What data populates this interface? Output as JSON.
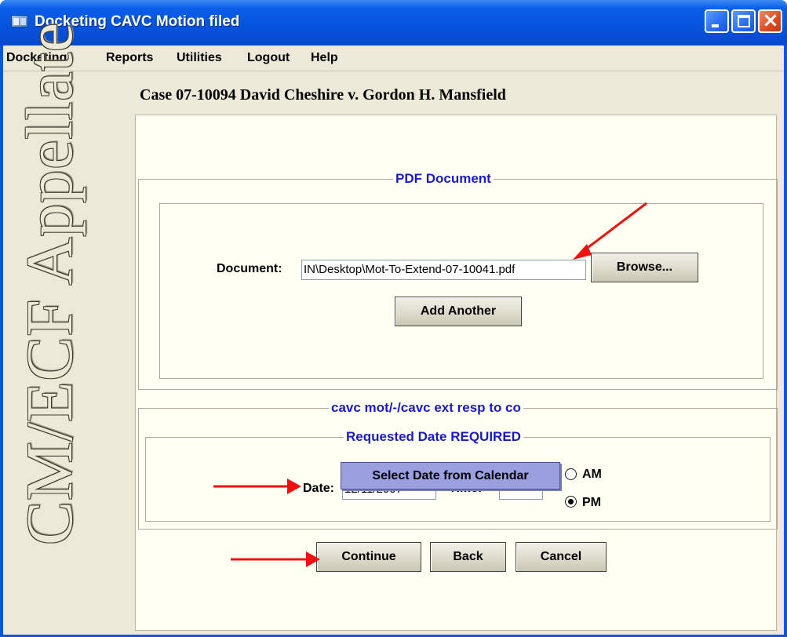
{
  "window": {
    "title": "Docketing CAVC Motion filed",
    "controls": [
      "minimize",
      "maximize",
      "close"
    ]
  },
  "menu": {
    "items": [
      "Docketing",
      "Reports",
      "Utilities",
      "Logout",
      "Help"
    ]
  },
  "sidebar": {
    "vertical_label": "CM/ECF Appellate"
  },
  "case": {
    "title": "Case 07-10094 David Cheshire v. Gordon H. Mansfield"
  },
  "pdf_section": {
    "legend": "PDF Document",
    "document_label": "Document:",
    "document_value": "IN\\Desktop\\Mot-To-Extend-07-10041.pdf",
    "browse_label": "Browse...",
    "add_another_label": "Add Another"
  },
  "motion_section": {
    "legend": "cavc mot/-/cavc ext resp to co",
    "date_group_legend": "Requested Date REQUIRED",
    "date_label": "Date:",
    "date_value": "12/11/2007",
    "time_label": "Time:",
    "time_value": "",
    "am_label": "AM",
    "pm_label": "PM",
    "selected_meridiem": "PM",
    "calendar_popup_label": "Select Date from Calendar"
  },
  "actions": {
    "continue_label": "Continue",
    "back_label": "Back",
    "cancel_label": "Cancel"
  },
  "colors": {
    "titlebar": "#0653dd",
    "panel_background": "#fffff2",
    "legend_text": "#1a1acc",
    "annotation_arrow": "#ee1111",
    "popup_background": "#9aa0df"
  }
}
